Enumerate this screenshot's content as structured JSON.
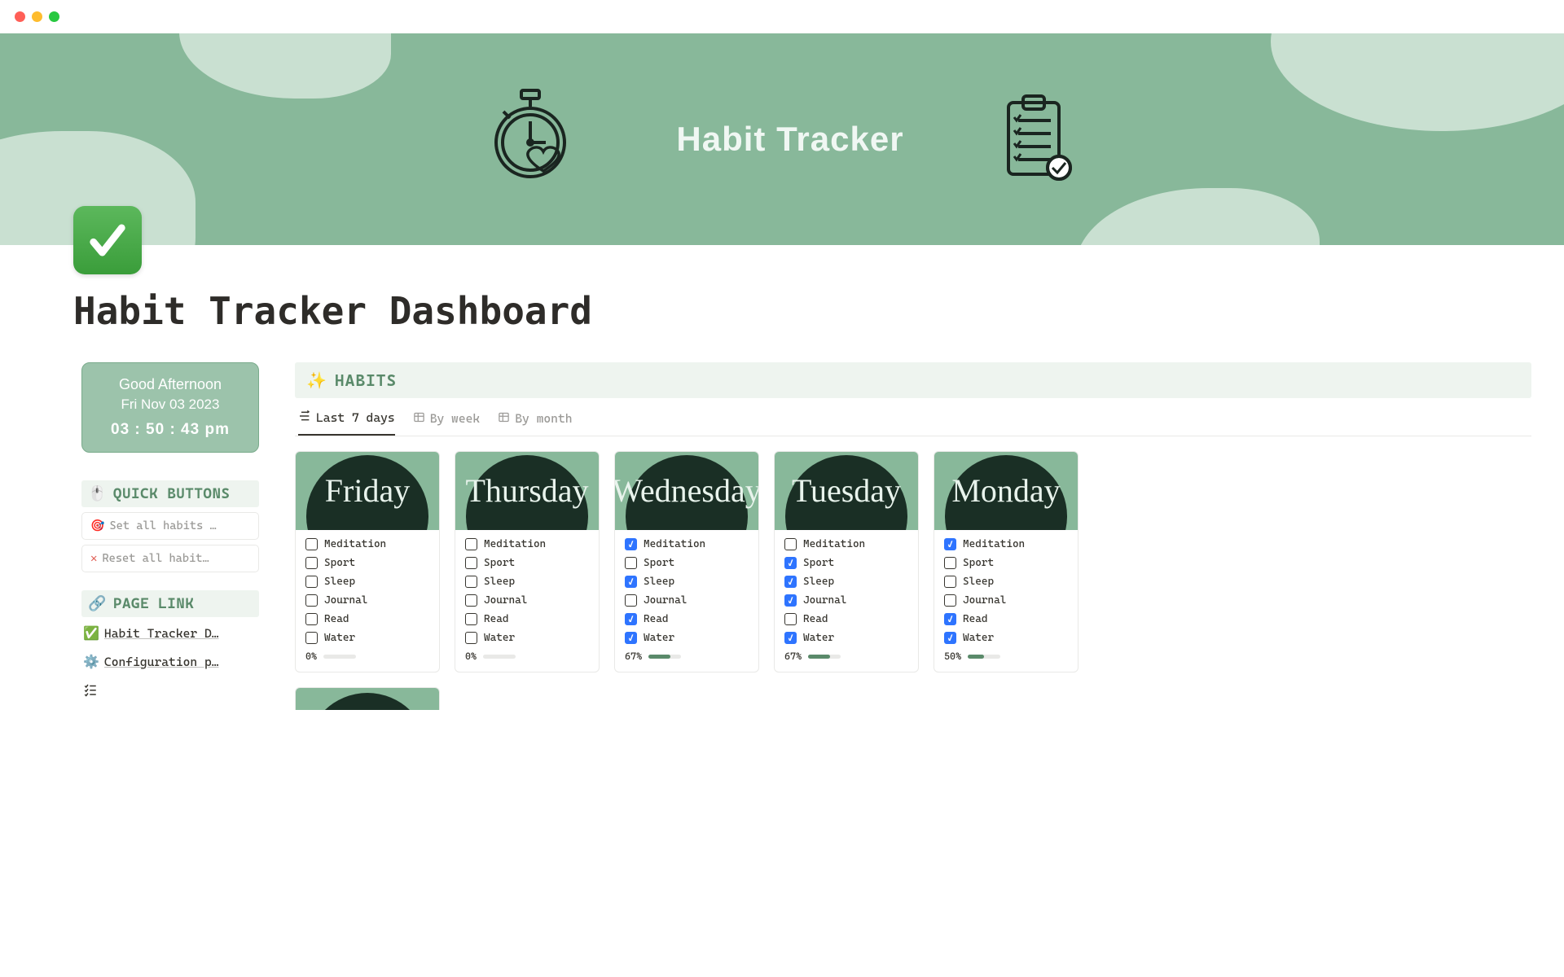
{
  "banner": {
    "title": "Habit Tracker"
  },
  "page": {
    "icon": "✓",
    "title": "Habit Tracker Dashboard"
  },
  "clock": {
    "greeting": "Good Afternoon",
    "date": "Fri Nov 03 2023",
    "time": "03  :  50  : 43 pm"
  },
  "sections": {
    "quick_buttons_label": "QUICK BUTTONS",
    "page_link_label": "PAGE LINK"
  },
  "quick_buttons": {
    "set_all": "Set all habits …",
    "reset_all": "Reset all habit…"
  },
  "page_links": {
    "dash": "Habit Tracker D…",
    "config": "Configuration p…"
  },
  "habits": {
    "header": "HABITS",
    "tabs": {
      "last7": "Last 7 days",
      "byweek": "By week",
      "bymonth": "By month"
    }
  },
  "habit_names": [
    "Meditation",
    "Sport",
    "Sleep",
    "Journal",
    "Read",
    "Water"
  ],
  "days": [
    {
      "name": "Friday",
      "checked": [
        false,
        false,
        false,
        false,
        false,
        false
      ],
      "pct": "0%",
      "fill": 0
    },
    {
      "name": "Thursday",
      "checked": [
        false,
        false,
        false,
        false,
        false,
        false
      ],
      "pct": "0%",
      "fill": 0
    },
    {
      "name": "Wednesday",
      "checked": [
        true,
        false,
        true,
        false,
        true,
        true
      ],
      "pct": "67%",
      "fill": 27
    },
    {
      "name": "Tuesday",
      "checked": [
        false,
        true,
        true,
        true,
        false,
        true
      ],
      "pct": "67%",
      "fill": 27
    },
    {
      "name": "Monday",
      "checked": [
        true,
        false,
        false,
        false,
        true,
        true
      ],
      "pct": "50%",
      "fill": 20
    }
  ]
}
